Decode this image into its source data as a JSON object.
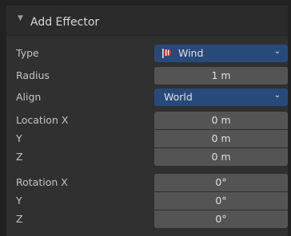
{
  "header": {
    "title": "Add Effector"
  },
  "rows": {
    "type": {
      "label": "Type",
      "value": "Wind",
      "icon": "wind-icon"
    },
    "radius": {
      "label": "Radius",
      "value": "1 m"
    },
    "align": {
      "label": "Align",
      "value": "World"
    },
    "location_x": {
      "label": "Location X",
      "value": "0 m"
    },
    "location_y": {
      "label": "Y",
      "value": "0 m"
    },
    "location_z": {
      "label": "Z",
      "value": "0 m"
    },
    "rotation_x": {
      "label": "Rotation X",
      "value": "0°"
    },
    "rotation_y": {
      "label": "Y",
      "value": "0°"
    },
    "rotation_z": {
      "label": "Z",
      "value": "0°"
    }
  },
  "colors": {
    "select_bg": "#284a7a",
    "field_bg": "#545454",
    "panel_bg": "#303030"
  }
}
